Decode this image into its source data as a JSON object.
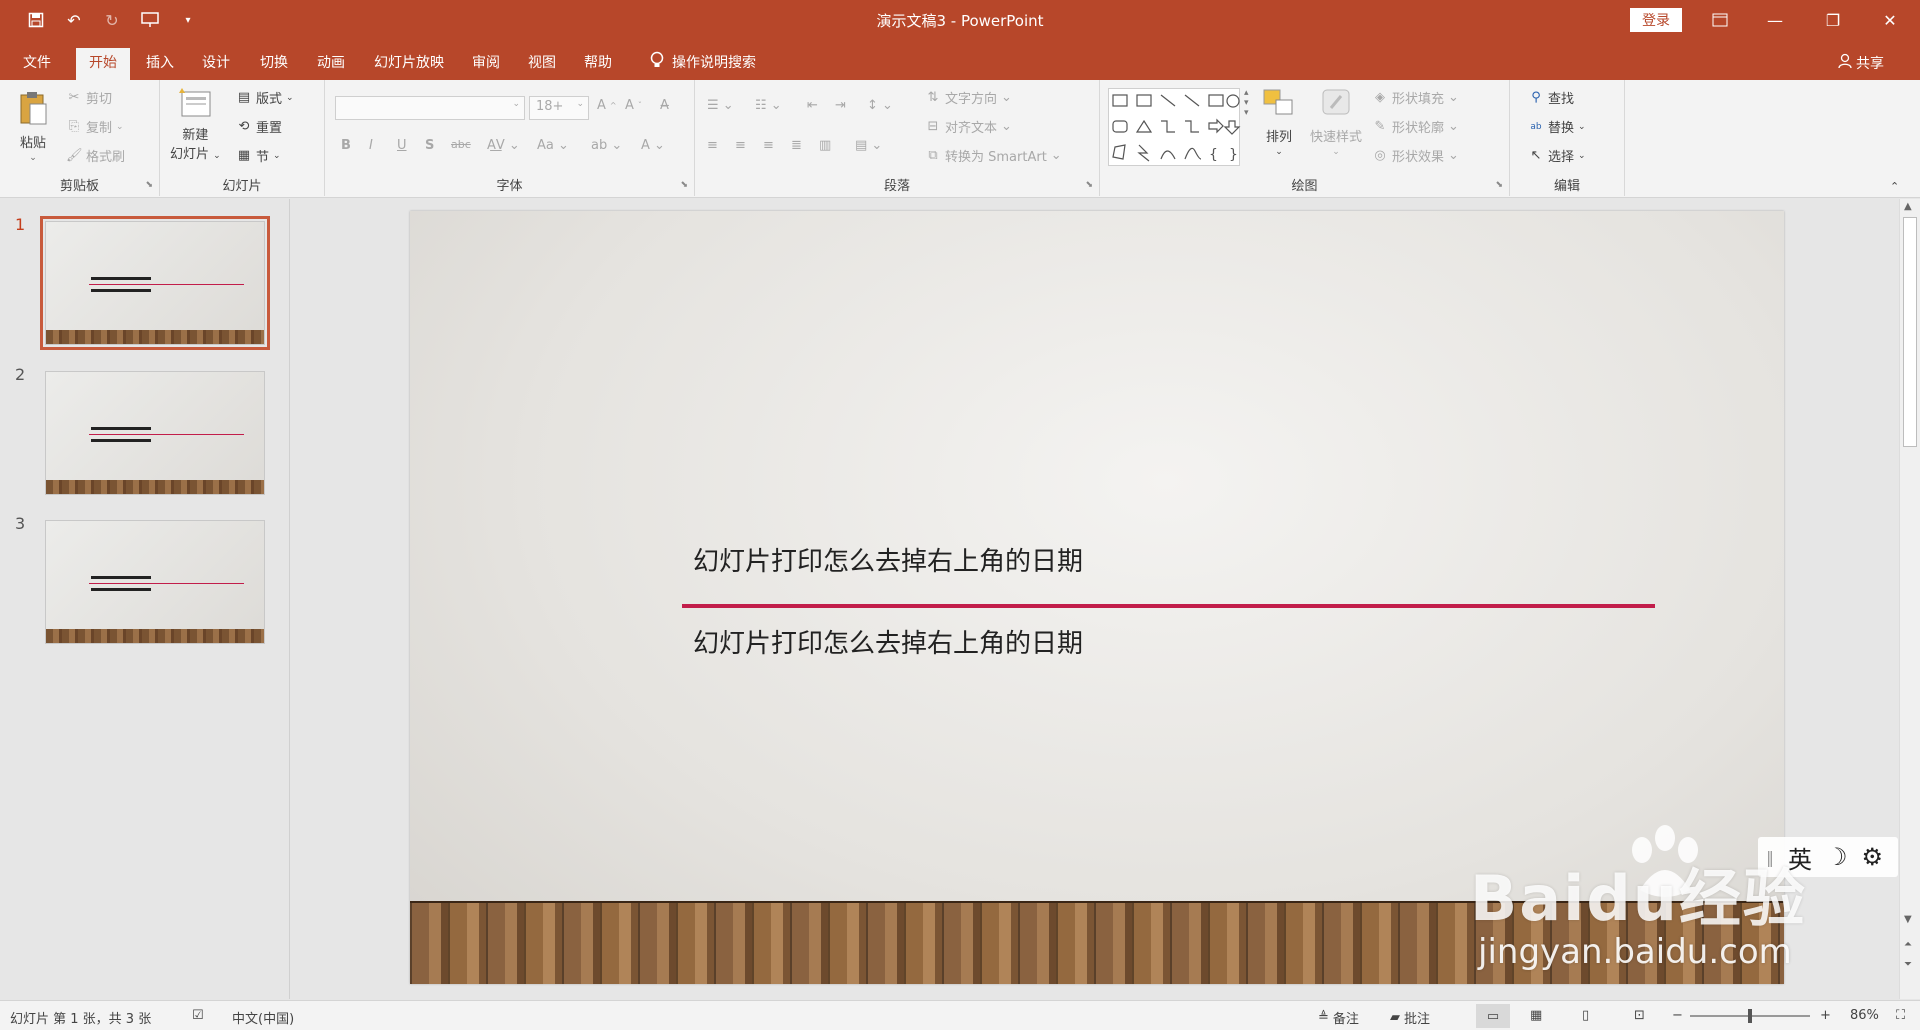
{
  "window": {
    "title": "演示文稿3 - PowerPoint",
    "login_label": "登录"
  },
  "tabs": [
    {
      "label": "文件"
    },
    {
      "label": "开始"
    },
    {
      "label": "插入"
    },
    {
      "label": "设计"
    },
    {
      "label": "切换"
    },
    {
      "label": "动画"
    },
    {
      "label": "幻灯片放映"
    },
    {
      "label": "审阅"
    },
    {
      "label": "视图"
    },
    {
      "label": "帮助"
    }
  ],
  "tell_me": "操作说明搜索",
  "share_label": "共享",
  "ribbon": {
    "clipboard": {
      "label": "剪贴板",
      "paste": "粘贴",
      "cut": "剪切",
      "copy": "复制",
      "format_painter": "格式刷"
    },
    "slides": {
      "label": "幻灯片",
      "new_slide_line1": "新建",
      "new_slide_line2": "幻灯片",
      "layout": "版式",
      "reset": "重置",
      "section": "节"
    },
    "font": {
      "label": "字体",
      "font_size": "18+"
    },
    "paragraph": {
      "label": "段落",
      "text_direction": "文字方向",
      "align_text": "对齐文本",
      "smartart": "转换为 SmartArt"
    },
    "drawing": {
      "label": "绘图",
      "arrange": "排列",
      "quick_styles": "快速样式",
      "shape_fill": "形状填充",
      "shape_outline": "形状轮廓",
      "shape_effects": "形状效果"
    },
    "editing": {
      "label": "编辑",
      "find": "查找",
      "replace": "替换",
      "select": "选择"
    }
  },
  "thumbnails": [
    {
      "number": "1"
    },
    {
      "number": "2"
    },
    {
      "number": "3"
    }
  ],
  "slide": {
    "title": "幻灯片打印怎么去掉右上角的日期",
    "subtitle": "幻灯片打印怎么去掉右上角的日期"
  },
  "ime": {
    "mode": "英"
  },
  "watermark": {
    "brand": "Baidu经验",
    "url": "jingyan.baidu.com"
  },
  "status": {
    "slide_info": "幻灯片 第 1 张，共 3 张",
    "language": "中文(中国)",
    "notes": "备注",
    "comments": "批注",
    "zoom": "86%"
  },
  "colors": {
    "accent": "#b7472a",
    "slide_rule": "#c21d4a"
  }
}
